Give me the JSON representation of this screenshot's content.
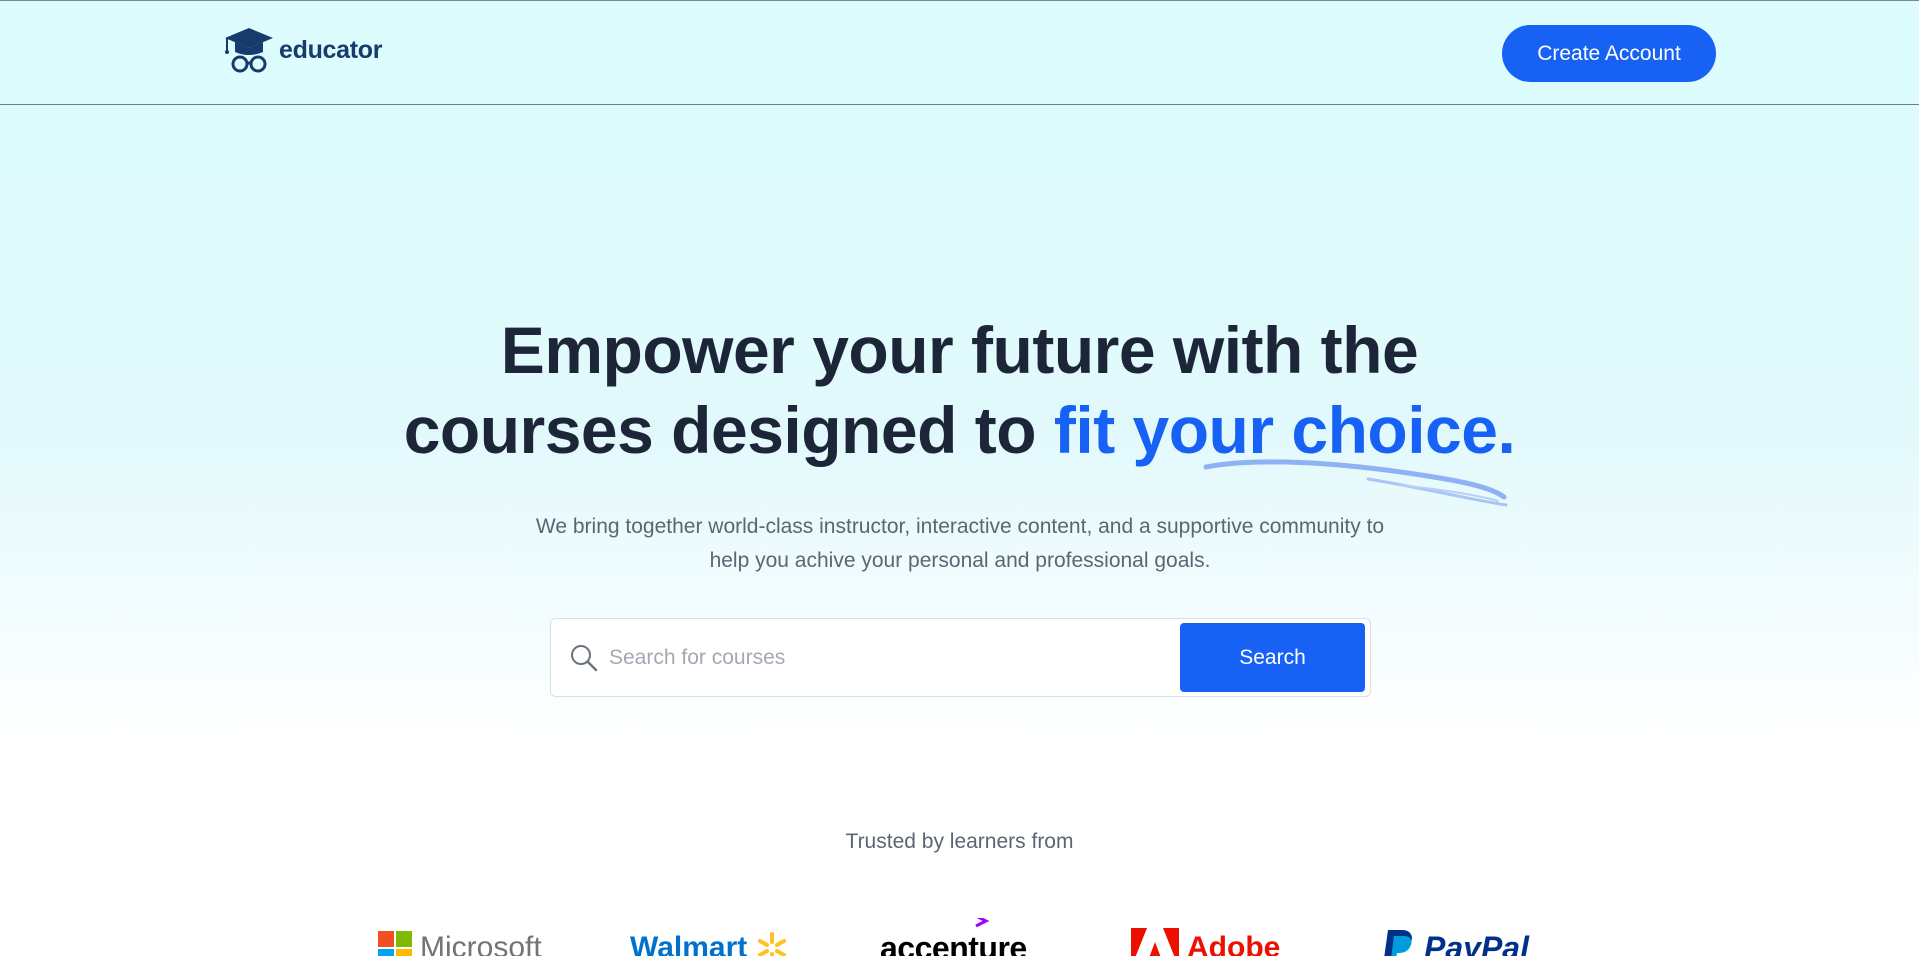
{
  "header": {
    "logo_text": "educator",
    "logo_icon": "graduation-cap-glasses-icon",
    "create_account_label": "Create Account"
  },
  "hero": {
    "title_line1": "Empower your future with the",
    "title_line2_plain": "courses designed to ",
    "title_line2_accent": "fit your choice.",
    "subtitle_line1": "We bring together world-class instructor, interactive content, and a supportive community to",
    "subtitle_line2": "help you achive your personal and professional goals."
  },
  "search": {
    "placeholder": "Search for courses",
    "value": "",
    "button_label": "Search",
    "icon": "search-icon"
  },
  "trusted": {
    "label": "Trusted by learners from",
    "brands": [
      "Microsoft",
      "Walmart",
      "accenture",
      "Adobe",
      "PayPal"
    ]
  },
  "colors": {
    "accent": "#1762f5",
    "heading": "#1d2638",
    "logo": "#173b6c",
    "background_top": "#dcfcfd"
  }
}
